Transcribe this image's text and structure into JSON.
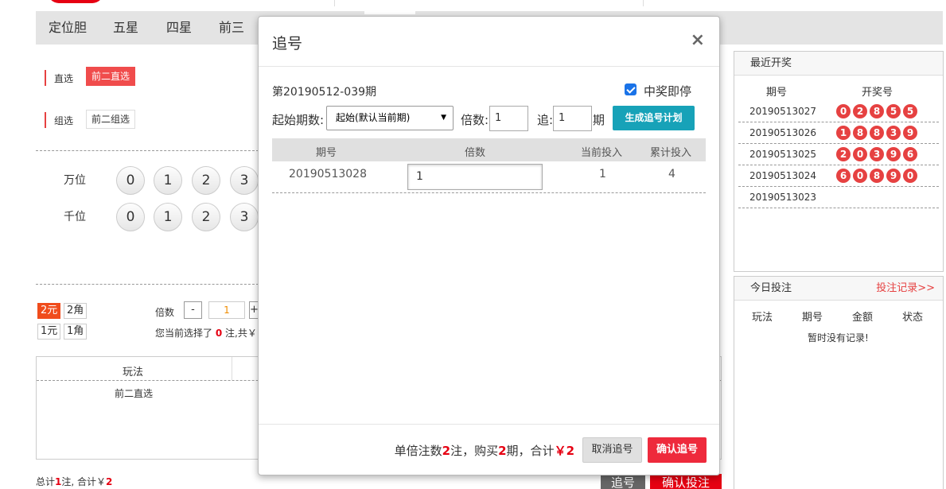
{
  "nav": {
    "tabs": [
      {
        "label": "定位胆"
      },
      {
        "label": "五星"
      },
      {
        "label": "四星"
      },
      {
        "label": "前三"
      }
    ]
  },
  "play": {
    "direct_label": "直选",
    "direct_option": "前二直选",
    "group_label": "组选",
    "group_option": "前二组选",
    "positions": [
      {
        "label": "万位",
        "balls": [
          "0",
          "1",
          "2",
          "3"
        ]
      },
      {
        "label": "千位",
        "balls": [
          "0",
          "1",
          "2",
          "3"
        ]
      }
    ]
  },
  "units": {
    "yuan2": "2元",
    "jiao2": "2角",
    "yuan1": "1元",
    "jiao1": "1角",
    "multiple_label": "倍数",
    "minus": "-",
    "multiple_value": "1",
    "plus": "+",
    "selected_prefix": "您当前选择了",
    "selected_count": "0",
    "selected_suffix": "注,共￥"
  },
  "bet_list": {
    "column_play": "玩法",
    "row_play": "前二直选"
  },
  "totals": {
    "prefix": "总计",
    "count": "1",
    "middle": "注, 合计￥",
    "amount": "2",
    "chase_button": "追号",
    "confirm_button": "确认投注"
  },
  "recent_draws": {
    "title": "最近开奖",
    "col_period": "期号",
    "col_numbers": "开奖号",
    "rows": [
      {
        "period": "20190513027",
        "numbers": [
          "0",
          "2",
          "8",
          "5",
          "5"
        ]
      },
      {
        "period": "20190513026",
        "numbers": [
          "1",
          "8",
          "8",
          "3",
          "9"
        ]
      },
      {
        "period": "20190513025",
        "numbers": [
          "2",
          "0",
          "3",
          "9",
          "6"
        ]
      },
      {
        "period": "20190513024",
        "numbers": [
          "6",
          "0",
          "8",
          "9",
          "0"
        ]
      },
      {
        "period": "20190513023",
        "numbers": []
      }
    ]
  },
  "today_bets": {
    "title": "今日投注",
    "more_link": "投注记录>>",
    "col_play": "玩法",
    "col_period": "期号",
    "col_amount": "金额",
    "col_status": "状态",
    "empty_text": "暂时没有记录!"
  },
  "modal": {
    "title": "追号",
    "close": "×",
    "period_title": "第20190512-039期",
    "stop_on_win_label": "中奖即停",
    "stop_on_win_checked": true,
    "start_label": "起始期数:",
    "start_select": "起始(默认当前期)",
    "multiple_label": "倍数:",
    "multiple_value": "1",
    "chase_label": "追:",
    "chase_value": "1",
    "chase_unit": "期",
    "generate_button": "生成追号计划",
    "plan_columns": {
      "period": "期号",
      "multiple": "倍数",
      "current": "当前投入",
      "cumulative": "累计投入"
    },
    "plan_rows": [
      {
        "period": "20190513028",
        "multiple": "1",
        "current": "1",
        "cumulative": "4"
      }
    ],
    "footer": {
      "part1": "单倍注数",
      "bets": "2",
      "part2": "注，购买",
      "periods": "2",
      "part3": "期，合计",
      "total": "￥2",
      "cancel_button": "取消追号",
      "confirm_button": "确认追号"
    }
  },
  "colors": {
    "accent_red": "#e64141",
    "teal_button": "#17a2b8",
    "confirm_red": "#ee2a3c"
  }
}
